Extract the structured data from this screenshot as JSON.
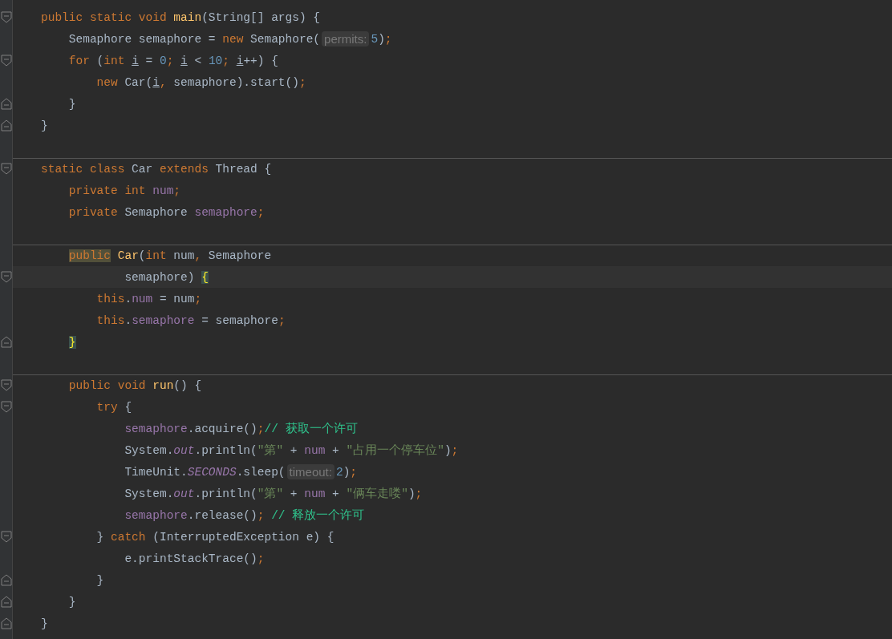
{
  "lines": [
    {
      "kind": "code",
      "fold_start": true,
      "tokens": [
        {
          "kind": "keyword",
          "text": "public static void "
        },
        {
          "kind": "method",
          "text": "main"
        },
        {
          "kind": "plain",
          "text": "(String[] args) {"
        }
      ]
    },
    {
      "kind": "code",
      "tokens": [
        {
          "kind": "plain",
          "text": "    Semaphore semaphore = "
        },
        {
          "kind": "keyword",
          "text": "new"
        },
        {
          "kind": "plain",
          "text": " Semaphore("
        },
        {
          "kind": "hint",
          "text": "permits:"
        },
        {
          "kind": "number",
          "text": "5"
        },
        {
          "kind": "plain",
          "text": ")"
        },
        {
          "kind": "punct",
          "text": ";"
        }
      ]
    },
    {
      "kind": "code",
      "fold_start": true,
      "tokens": [
        {
          "kind": "keyword",
          "text": "    for"
        },
        {
          "kind": "plain",
          "text": " ("
        },
        {
          "kind": "keyword",
          "text": "int "
        },
        {
          "kind": "local",
          "text": "i"
        },
        {
          "kind": "plain",
          "text": " = "
        },
        {
          "kind": "number",
          "text": "0"
        },
        {
          "kind": "punct",
          "text": "; "
        },
        {
          "kind": "local",
          "text": "i"
        },
        {
          "kind": "plain",
          "text": " < "
        },
        {
          "kind": "number",
          "text": "10"
        },
        {
          "kind": "punct",
          "text": "; "
        },
        {
          "kind": "local",
          "text": "i"
        },
        {
          "kind": "plain",
          "text": "++) {"
        }
      ]
    },
    {
      "kind": "code",
      "tokens": [
        {
          "kind": "keyword",
          "text": "        new"
        },
        {
          "kind": "plain",
          "text": " Car("
        },
        {
          "kind": "local",
          "text": "i"
        },
        {
          "kind": "punct",
          "text": ","
        },
        {
          "kind": "plain",
          "text": " semaphore).start()"
        },
        {
          "kind": "punct",
          "text": ";"
        }
      ]
    },
    {
      "kind": "code",
      "fold_end": true,
      "tokens": [
        {
          "kind": "plain",
          "text": "    }"
        }
      ]
    },
    {
      "kind": "code",
      "fold_end": true,
      "tokens": [
        {
          "kind": "plain",
          "text": "}"
        }
      ]
    },
    {
      "kind": "blank"
    },
    {
      "kind": "code",
      "fold_start": true,
      "separator": true,
      "tokens": [
        {
          "kind": "keyword",
          "text": "static class"
        },
        {
          "kind": "plain",
          "text": " Car "
        },
        {
          "kind": "keyword",
          "text": "extends"
        },
        {
          "kind": "plain",
          "text": " Thread {"
        }
      ]
    },
    {
      "kind": "code",
      "tokens": [
        {
          "kind": "keyword",
          "text": "    private int "
        },
        {
          "kind": "field",
          "text": "num"
        },
        {
          "kind": "punct",
          "text": ";"
        }
      ]
    },
    {
      "kind": "code",
      "tokens": [
        {
          "kind": "keyword",
          "text": "    private"
        },
        {
          "kind": "plain",
          "text": " Semaphore "
        },
        {
          "kind": "field",
          "text": "semaphore"
        },
        {
          "kind": "punct",
          "text": ";"
        }
      ]
    },
    {
      "kind": "blank"
    },
    {
      "kind": "code",
      "separator": true,
      "tokens": [
        {
          "kind": "keyword",
          "text": "    public",
          "usage_highlight": true
        },
        {
          "kind": "method",
          "text": " Car"
        },
        {
          "kind": "plain",
          "text": "("
        },
        {
          "kind": "keyword",
          "text": "int"
        },
        {
          "kind": "plain",
          "text": " num"
        },
        {
          "kind": "punct",
          "text": ","
        },
        {
          "kind": "plain",
          "text": " Semaphore"
        }
      ]
    },
    {
      "kind": "code",
      "fold_start": true,
      "current": true,
      "tokens": [
        {
          "kind": "plain",
          "text": "            semaphore) "
        },
        {
          "kind": "plain",
          "text": "{",
          "brace_match": true
        }
      ]
    },
    {
      "kind": "code",
      "tokens": [
        {
          "kind": "keyword",
          "text": "        this"
        },
        {
          "kind": "plain",
          "text": "."
        },
        {
          "kind": "field",
          "text": "num"
        },
        {
          "kind": "plain",
          "text": " = num"
        },
        {
          "kind": "punct",
          "text": ";"
        }
      ]
    },
    {
      "kind": "code",
      "tokens": [
        {
          "kind": "keyword",
          "text": "        this"
        },
        {
          "kind": "plain",
          "text": "."
        },
        {
          "kind": "field",
          "text": "semaphore"
        },
        {
          "kind": "plain",
          "text": " = semaphore"
        },
        {
          "kind": "punct",
          "text": ";"
        }
      ]
    },
    {
      "kind": "code",
      "fold_end": true,
      "tokens": [
        {
          "kind": "plain",
          "text": "    }",
          "brace_match": true
        }
      ]
    },
    {
      "kind": "blank"
    },
    {
      "kind": "code",
      "fold_start": true,
      "separator": true,
      "tokens": [
        {
          "kind": "keyword",
          "text": "    public void "
        },
        {
          "kind": "method",
          "text": "run"
        },
        {
          "kind": "plain",
          "text": "() {"
        }
      ]
    },
    {
      "kind": "code",
      "fold_start": true,
      "tokens": [
        {
          "kind": "keyword",
          "text": "        try"
        },
        {
          "kind": "plain",
          "text": " {"
        }
      ]
    },
    {
      "kind": "code",
      "tokens": [
        {
          "kind": "field",
          "text": "            semaphore"
        },
        {
          "kind": "plain",
          "text": ".acquire()"
        },
        {
          "kind": "punct",
          "text": ";"
        },
        {
          "kind": "comment",
          "text": "// 获取一个许可"
        }
      ]
    },
    {
      "kind": "code",
      "tokens": [
        {
          "kind": "plain",
          "text": "            System."
        },
        {
          "kind": "static",
          "text": "out"
        },
        {
          "kind": "plain",
          "text": ".println("
        },
        {
          "kind": "string",
          "text": "\"第\""
        },
        {
          "kind": "plain",
          "text": " + "
        },
        {
          "kind": "field",
          "text": "num"
        },
        {
          "kind": "plain",
          "text": " + "
        },
        {
          "kind": "string",
          "text": "\"占用一个停车位\""
        },
        {
          "kind": "plain",
          "text": ")"
        },
        {
          "kind": "punct",
          "text": ";"
        }
      ]
    },
    {
      "kind": "code",
      "tokens": [
        {
          "kind": "plain",
          "text": "            TimeUnit."
        },
        {
          "kind": "static",
          "text": "SECONDS"
        },
        {
          "kind": "plain",
          "text": ".sleep("
        },
        {
          "kind": "hint",
          "text": "timeout:"
        },
        {
          "kind": "number",
          "text": "2"
        },
        {
          "kind": "plain",
          "text": ")"
        },
        {
          "kind": "punct",
          "text": ";"
        }
      ]
    },
    {
      "kind": "code",
      "tokens": [
        {
          "kind": "plain",
          "text": "            System."
        },
        {
          "kind": "static",
          "text": "out"
        },
        {
          "kind": "plain",
          "text": ".println("
        },
        {
          "kind": "string",
          "text": "\"第\""
        },
        {
          "kind": "plain",
          "text": " + "
        },
        {
          "kind": "field",
          "text": "num"
        },
        {
          "kind": "plain",
          "text": " + "
        },
        {
          "kind": "string",
          "text": "\"俩车走喽\""
        },
        {
          "kind": "plain",
          "text": ")"
        },
        {
          "kind": "punct",
          "text": ";"
        }
      ]
    },
    {
      "kind": "code",
      "tokens": [
        {
          "kind": "field",
          "text": "            semaphore"
        },
        {
          "kind": "plain",
          "text": ".release()"
        },
        {
          "kind": "punct",
          "text": "; "
        },
        {
          "kind": "comment",
          "text": "// 释放一个许可"
        }
      ]
    },
    {
      "kind": "code",
      "fold_start": true,
      "tokens": [
        {
          "kind": "plain",
          "text": "        } "
        },
        {
          "kind": "keyword",
          "text": "catch"
        },
        {
          "kind": "plain",
          "text": " (InterruptedException e) {"
        }
      ]
    },
    {
      "kind": "code",
      "tokens": [
        {
          "kind": "plain",
          "text": "            e.printStackTrace()"
        },
        {
          "kind": "punct",
          "text": ";"
        }
      ]
    },
    {
      "kind": "code",
      "fold_end": true,
      "tokens": [
        {
          "kind": "plain",
          "text": "        }"
        }
      ]
    },
    {
      "kind": "code",
      "fold_end": true,
      "tokens": [
        {
          "kind": "plain",
          "text": "    }"
        }
      ]
    },
    {
      "kind": "code",
      "fold_end": true,
      "tokens": [
        {
          "kind": "plain",
          "text": "}"
        }
      ]
    }
  ]
}
